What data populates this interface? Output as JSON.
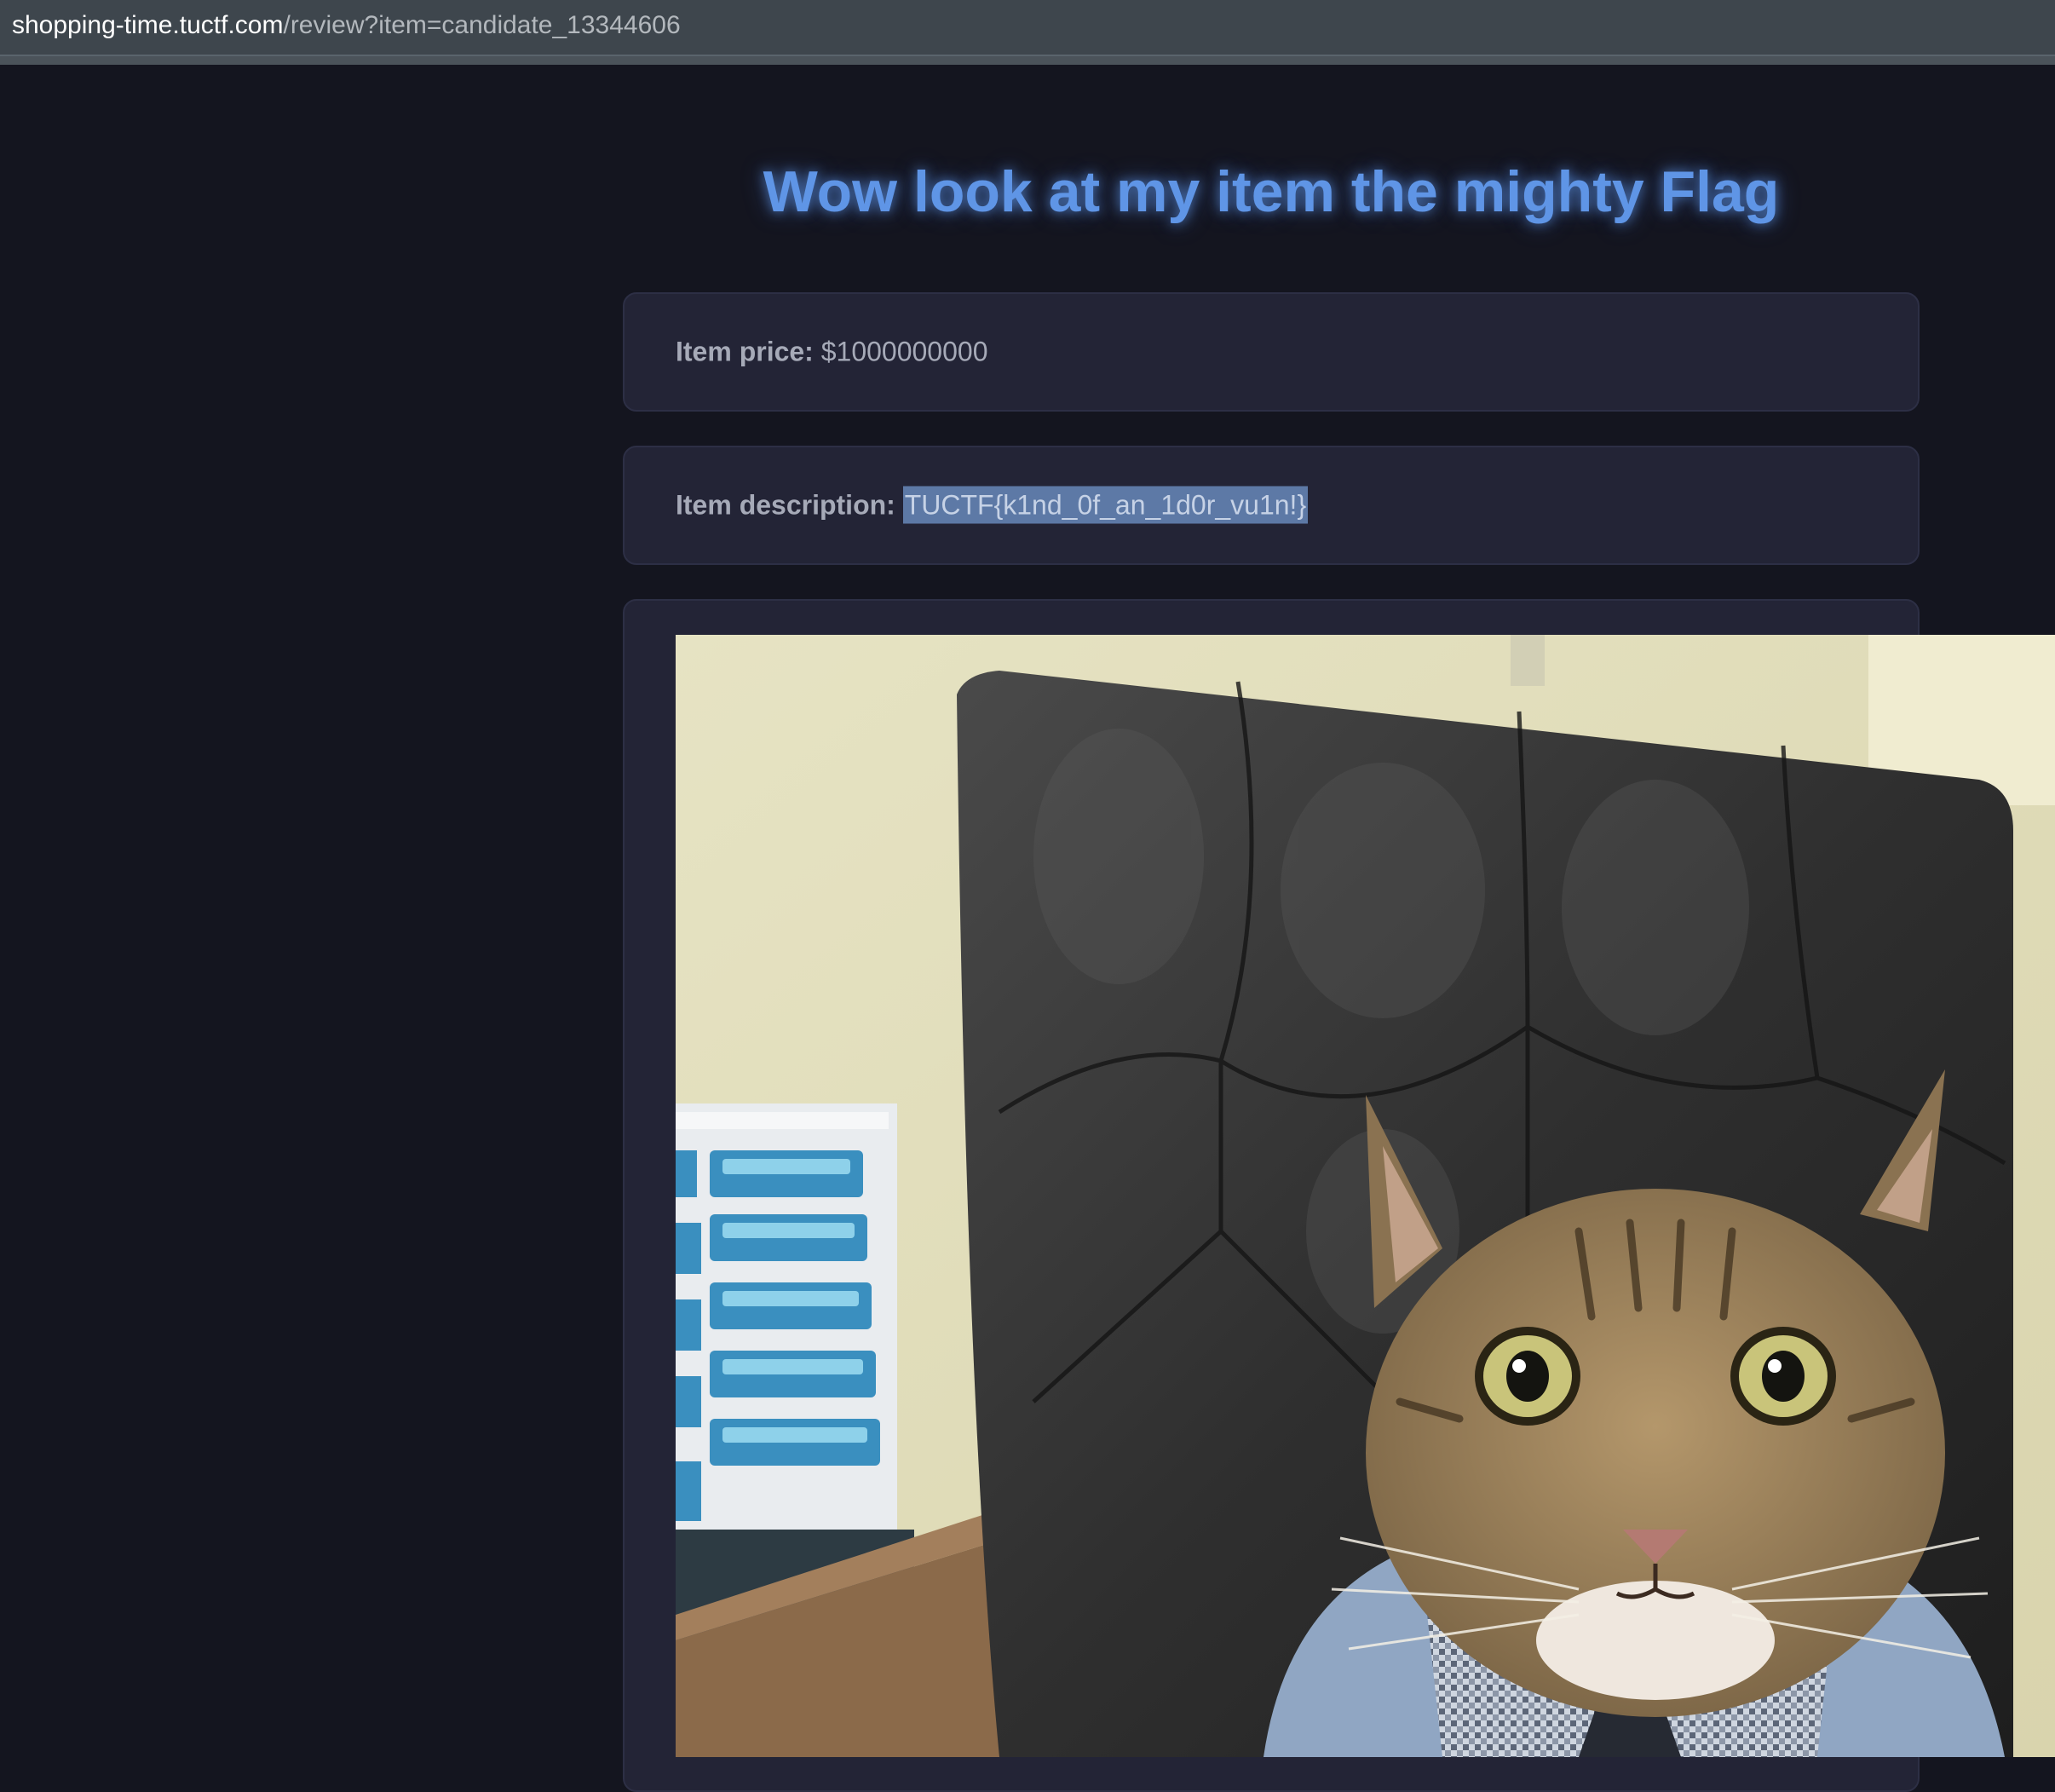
{
  "browser": {
    "url_host": "shopping-time.tuctf.com",
    "url_path": "/review?item=candidate_13344606"
  },
  "page": {
    "title": "Wow look at my item the mighty Flag"
  },
  "item": {
    "price_label": "Item price:",
    "price_value": "$1000000000",
    "description_label": "Item description:",
    "description_value": "TUCTF{k1nd_0f_an_1d0r_vu1n!}"
  },
  "image": {
    "subject": "cat-in-office-chair-photo"
  },
  "colors": {
    "background": "#14151f",
    "card": "#232436",
    "title": "#5f95e6",
    "selection": "#5d79a6"
  }
}
